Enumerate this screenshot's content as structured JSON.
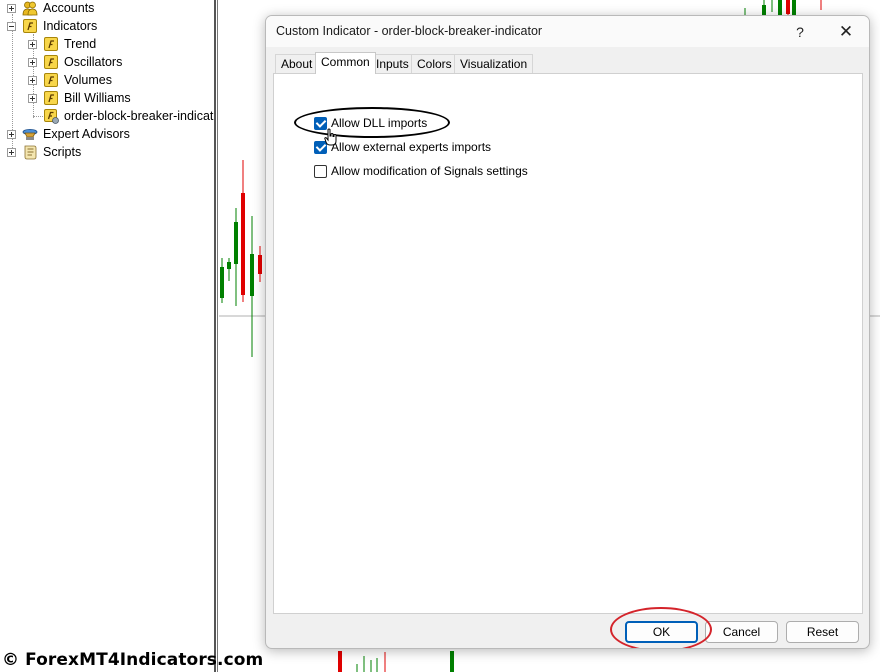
{
  "navigator": {
    "items": [
      {
        "label": "Accounts",
        "icon": "accounts-icon"
      },
      {
        "label": "Indicators",
        "icon": "indicator-folder-icon"
      },
      {
        "label": "Trend",
        "icon": "indicator-folder-icon"
      },
      {
        "label": "Oscillators",
        "icon": "indicator-folder-icon"
      },
      {
        "label": "Volumes",
        "icon": "indicator-folder-icon"
      },
      {
        "label": "Bill Williams",
        "icon": "indicator-folder-icon"
      },
      {
        "label": "order-block-breaker-indicat",
        "icon": "custom-indicator-icon"
      },
      {
        "label": "Expert Advisors",
        "icon": "expert-advisors-icon"
      },
      {
        "label": "Scripts",
        "icon": "scripts-icon"
      }
    ]
  },
  "watermark": "© ForexMT4Indicators.com",
  "dialog": {
    "title": "Custom Indicator - order-block-breaker-indicator",
    "help": "?",
    "close": "✕",
    "tabs": [
      {
        "label": "About",
        "active": false
      },
      {
        "label": "Common",
        "active": true
      },
      {
        "label": "Inputs",
        "active": false
      },
      {
        "label": "Colors",
        "active": false
      },
      {
        "label": "Visualization",
        "active": false
      }
    ],
    "options": [
      {
        "label": "Allow DLL imports",
        "checked": true
      },
      {
        "label": "Allow external experts imports",
        "checked": true
      },
      {
        "label": "Allow modification of Signals settings",
        "checked": false
      }
    ],
    "buttons": {
      "ok": "OK",
      "cancel": "Cancel",
      "reset": "Reset"
    }
  },
  "colors": {
    "bull_candle": "#008000",
    "bear_candle": "#e00000",
    "accent": "#005fb8",
    "annotation_red": "#d4242b"
  }
}
